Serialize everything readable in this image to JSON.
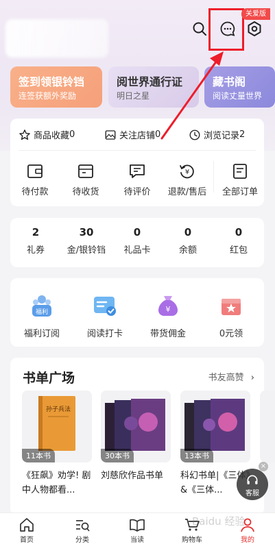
{
  "header": {
    "care_badge": "关爱版",
    "icons": [
      "search-icon",
      "message-icon",
      "settings-icon"
    ]
  },
  "banners": [
    {
      "title": "签到领银铃铛",
      "subtitle": "连签获额外奖励"
    },
    {
      "title": "阅世界通行证",
      "subtitle": "明日之星"
    },
    {
      "title": "藏书阁",
      "subtitle": "阅读丈量世界"
    }
  ],
  "quick_links": [
    {
      "label": "商品收藏",
      "count": "0"
    },
    {
      "label": "关注店铺",
      "count": "0"
    },
    {
      "label": "浏览记录",
      "count": "2"
    }
  ],
  "orders": [
    {
      "label": "待付款"
    },
    {
      "label": "待收货"
    },
    {
      "label": "待评价"
    },
    {
      "label": "退款/售后"
    },
    {
      "label": "全部订单"
    }
  ],
  "assets": [
    {
      "value": "2",
      "label": "礼券"
    },
    {
      "value": "30",
      "label": "金/银铃铛"
    },
    {
      "value": "0",
      "label": "礼品卡"
    },
    {
      "value": "0",
      "label": "余额"
    },
    {
      "value": "0",
      "label": "红包"
    }
  ],
  "services": [
    {
      "label": "福利订阅",
      "icon_text": "福利"
    },
    {
      "label": "阅读打卡"
    },
    {
      "label": "带货佣金"
    },
    {
      "label": "0元领"
    }
  ],
  "book_lists": {
    "title": "书单广场",
    "more": "书友高赞",
    "items": [
      {
        "count": "11本书",
        "title": "《狂飙》劝学! 剧中人物都看...",
        "cover_text": "孙子兵法"
      },
      {
        "count": "30本书",
        "title": "刘慈欣作品书单"
      },
      {
        "count": "13本书",
        "title": "科幻书单|《三体》&《三体..."
      }
    ]
  },
  "floating": {
    "label": "客服"
  },
  "tabbar": [
    {
      "label": "首页"
    },
    {
      "label": "分类"
    },
    {
      "label": "当读"
    },
    {
      "label": "购物车"
    },
    {
      "label": "我的"
    }
  ],
  "watermark": "Baidu 经验",
  "colors": {
    "accent": "#e63232",
    "highlight": "#ee1d2a",
    "banner1": "#f7a882",
    "banner3": "#9a95e1"
  }
}
